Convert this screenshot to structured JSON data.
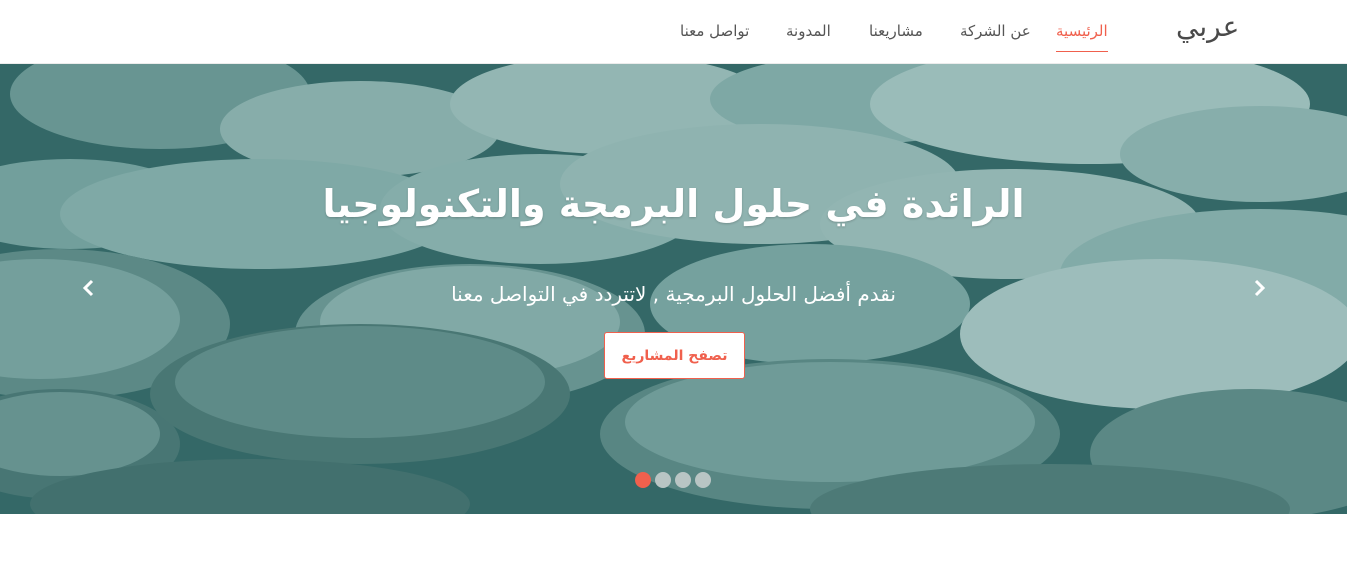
{
  "brand": "عربي",
  "nav": {
    "items": [
      {
        "label": "الرئيسية",
        "active": true
      },
      {
        "label": "عن الشركة",
        "active": false
      },
      {
        "label": "مشاريعنا",
        "active": false
      },
      {
        "label": "المدونة",
        "active": false
      },
      {
        "label": "تواصل معنا",
        "active": false
      }
    ]
  },
  "hero": {
    "title": "الرائدة في حلول البرمجة والتكنولوجيا",
    "subtitle": "نقدم أفضل الحلول البرمجية , لاتتردد في التواصل معنا",
    "button_label": "تصفح المشاريع",
    "slides_count": 4,
    "active_slide": 1
  },
  "colors": {
    "accent": "#f0604d",
    "overlay": "#2f6b68",
    "text": "#555555"
  },
  "icons": {
    "prev": "chevron-left-icon",
    "next": "chevron-right-icon"
  }
}
